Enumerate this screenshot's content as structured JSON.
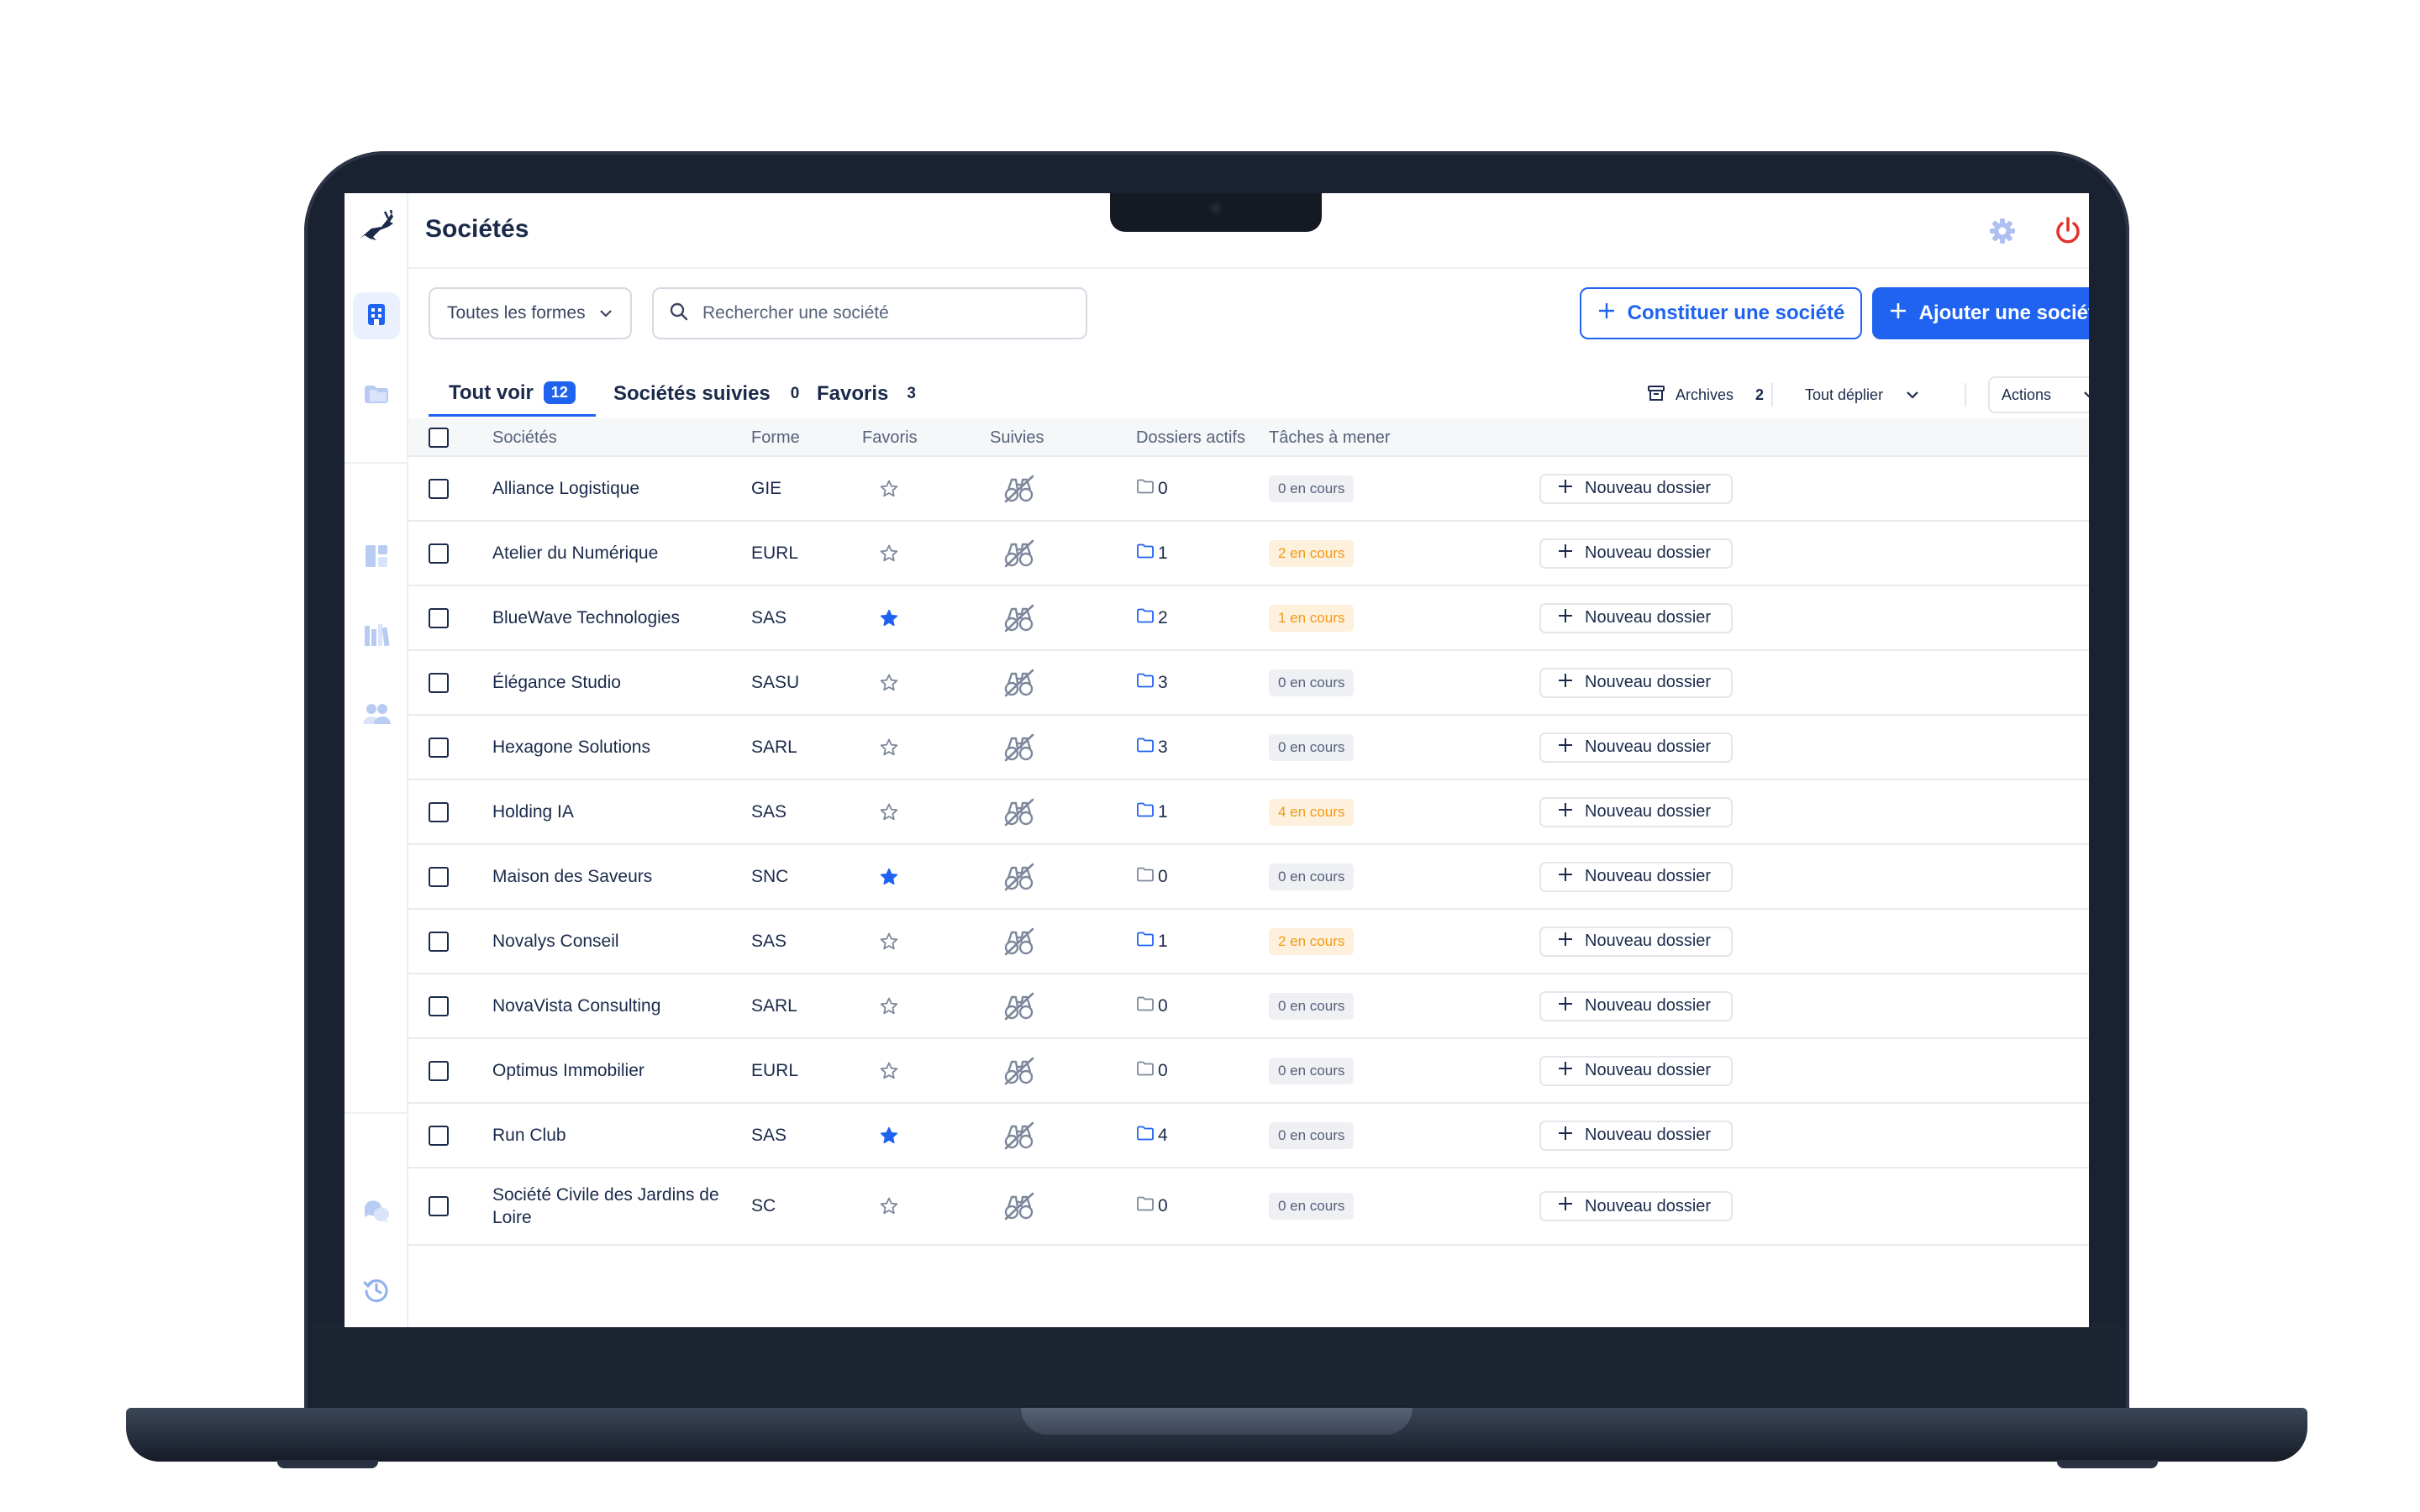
{
  "app": {
    "title": "Sociétés"
  },
  "toolbar": {
    "forme_filter": "Toutes les formes",
    "search_placeholder": "Rechercher une société",
    "constituer_label": "Constituer une société",
    "ajouter_label": "Ajouter une société"
  },
  "tabs": [
    {
      "label": "Tout voir",
      "count": "12"
    },
    {
      "label": "Sociétés suivies",
      "count": "0"
    },
    {
      "label": "Favoris",
      "count": "3"
    }
  ],
  "controls": {
    "archives_label": "Archives",
    "archives_count": "2",
    "expand_label": "Tout déplier",
    "actions_label": "Actions"
  },
  "table": {
    "headers": {
      "name": "Sociétés",
      "forme": "Forme",
      "favoris": "Favoris",
      "suivies": "Suivies",
      "dossiers": "Dossiers actifs",
      "taches": "Tâches à mener"
    },
    "new_dossier_label": "Nouveau dossier",
    "rows": [
      {
        "name": "Alliance Logistique",
        "forme": "GIE",
        "favorite": false,
        "dossiers": "0",
        "tasks": "0 en cours",
        "pending": false
      },
      {
        "name": "Atelier du Numérique",
        "forme": "EURL",
        "favorite": false,
        "dossiers": "1",
        "tasks": "2 en cours",
        "pending": true
      },
      {
        "name": "BlueWave Technologies",
        "forme": "SAS",
        "favorite": true,
        "dossiers": "2",
        "tasks": "1 en cours",
        "pending": true
      },
      {
        "name": "Élégance Studio",
        "forme": "SASU",
        "favorite": false,
        "dossiers": "3",
        "tasks": "0 en cours",
        "pending": false
      },
      {
        "name": "Hexagone Solutions",
        "forme": "SARL",
        "favorite": false,
        "dossiers": "3",
        "tasks": "0 en cours",
        "pending": false
      },
      {
        "name": "Holding IA",
        "forme": "SAS",
        "favorite": false,
        "dossiers": "1",
        "tasks": "4 en cours",
        "pending": true
      },
      {
        "name": "Maison des Saveurs",
        "forme": "SNC",
        "favorite": true,
        "dossiers": "0",
        "tasks": "0 en cours",
        "pending": false
      },
      {
        "name": "Novalys Conseil",
        "forme": "SAS",
        "favorite": false,
        "dossiers": "1",
        "tasks": "2 en cours",
        "pending": true
      },
      {
        "name": "NovaVista Consulting",
        "forme": "SARL",
        "favorite": false,
        "dossiers": "0",
        "tasks": "0 en cours",
        "pending": false
      },
      {
        "name": "Optimus Immobilier",
        "forme": "EURL",
        "favorite": false,
        "dossiers": "0",
        "tasks": "0 en cours",
        "pending": false
      },
      {
        "name": "Run Club",
        "forme": "SAS",
        "favorite": true,
        "dossiers": "4",
        "tasks": "0 en cours",
        "pending": false
      },
      {
        "name": "Société Civile des Jardins de Loire",
        "forme": "SC",
        "favorite": false,
        "dossiers": "0",
        "tasks": "0 en cours",
        "pending": false
      }
    ]
  },
  "colors": {
    "accent": "#1f63f0",
    "text": "#1b2a4a",
    "warning_text": "#f39a16",
    "warning_bg": "#fdf0dc",
    "power": "#e2312d"
  }
}
